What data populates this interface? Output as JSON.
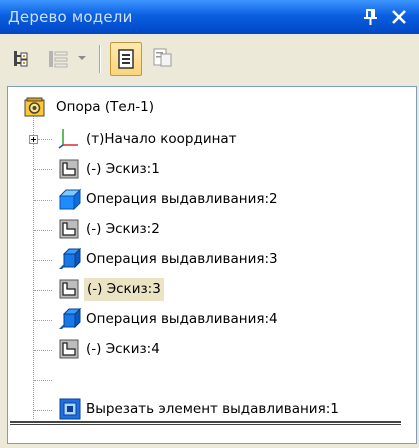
{
  "window": {
    "title": "Дерево модели",
    "pin_icon": "pin-icon",
    "close_icon": "close-icon",
    "title_color": "#0a5fe0"
  },
  "toolbar": {
    "buttons": [
      {
        "icon": "tree-structure-icon",
        "active": false,
        "enabled": true
      },
      {
        "icon": "list-view-dropdown-icon",
        "active": false,
        "enabled": false
      },
      {
        "icon": "page-view-icon",
        "active": true,
        "enabled": true
      },
      {
        "icon": "page-copy-icon",
        "active": false,
        "enabled": false
      }
    ]
  },
  "tree": {
    "root": {
      "label": "Опора (Тел-1)",
      "icon": "part-icon"
    },
    "items": [
      {
        "label": "(т)Начало координат",
        "icon": "axes-icon",
        "expandable": true
      },
      {
        "label": "(-) Эскиз:1",
        "icon": "sketch-icon"
      },
      {
        "label": "Операция выдавливания:2",
        "icon": "extrude-icon"
      },
      {
        "label": "(-) Эскиз:2",
        "icon": "sketch-icon"
      },
      {
        "label": "Операция выдавливания:3",
        "icon": "extrude-icon"
      },
      {
        "label": "(-) Эскиз:3",
        "icon": "sketch-icon",
        "selected": true
      },
      {
        "label": "Операция выдавливания:4",
        "icon": "extrude-icon"
      },
      {
        "label": "(-) Эскиз:4",
        "icon": "sketch-icon"
      },
      {
        "label": "Вырезать элемент выдавливания:1",
        "icon": "cut-extrude-icon"
      }
    ],
    "selection_color": "#ebe4c4"
  }
}
